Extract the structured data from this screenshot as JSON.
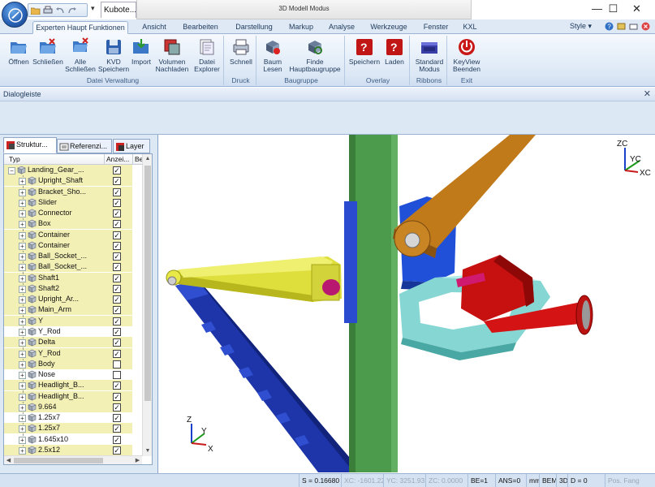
{
  "window": {
    "doc_title": "Kubote...",
    "mode_title": "3D Modell Modus",
    "minimize": "—",
    "maximize": "☐",
    "close": "✕"
  },
  "ribbon": {
    "tabs": [
      "Experten Haupt Funktionen",
      "Ansicht",
      "Bearbeiten",
      "Darstellung",
      "Markup",
      "Analyse",
      "Werkzeuge",
      "Fenster",
      "KXL"
    ],
    "style_label": "Style",
    "groups": {
      "datei": "Datei Verwaltung",
      "druck": "Druck",
      "baugruppe": "Baugruppe",
      "overlay": "Overlay",
      "ribbons": "Ribbons",
      "exit": "Exit"
    },
    "buttons": {
      "oeffnen": "Öffnen",
      "schliessen": "Schließen",
      "alle_l1": "Alle",
      "alle_l2": "Schließen",
      "kvd_l1": "KVD",
      "kvd_l2": "Speichern",
      "import": "Import",
      "volumen_l1": "Volumen",
      "volumen_l2": "Nachladen",
      "datei_l1": "Datei",
      "datei_l2": "Explorer",
      "schnell": "Schnell",
      "baum_l1": "Baum",
      "baum_l2": "Lesen",
      "finde_l1": "Finde",
      "finde_l2": "Hauptbaugruppe",
      "speichern": "Speichern",
      "laden": "Laden",
      "standard_l1": "Standard",
      "standard_l2": "Modus",
      "keyview_l1": "KeyView",
      "keyview_l2": "Beenden"
    }
  },
  "dialog": {
    "title": "Dialogleiste",
    "close": "✕"
  },
  "panel": {
    "tabs": [
      "Struktur...",
      "Referenzi...",
      "Layer"
    ],
    "columns": {
      "typ": "Typ",
      "anzeige": "Anzei...",
      "be": "Be"
    },
    "rows": [
      {
        "label": "Landing_Gear_...",
        "checked": true,
        "hl": true,
        "root": true
      },
      {
        "label": "Upright_Shaft",
        "checked": true,
        "hl": true
      },
      {
        "label": "Bracket_Sho...",
        "checked": true,
        "hl": true
      },
      {
        "label": "Slider",
        "checked": true,
        "hl": true
      },
      {
        "label": "Connector",
        "checked": true,
        "hl": true
      },
      {
        "label": "Box",
        "checked": true,
        "hl": true
      },
      {
        "label": "Container",
        "checked": true,
        "hl": true
      },
      {
        "label": "Container",
        "checked": true,
        "hl": true
      },
      {
        "label": "Ball_Socket_...",
        "checked": true,
        "hl": true
      },
      {
        "label": "Ball_Socket_...",
        "checked": true,
        "hl": true
      },
      {
        "label": "Shaft1",
        "checked": true,
        "hl": true
      },
      {
        "label": "Shaft2",
        "checked": true,
        "hl": true
      },
      {
        "label": "Upright_Ar...",
        "checked": true,
        "hl": true
      },
      {
        "label": "Main_Arm",
        "checked": true,
        "hl": true
      },
      {
        "label": "Y",
        "checked": true,
        "hl": true
      },
      {
        "label": "Y_Rod",
        "checked": true,
        "hl": false
      },
      {
        "label": "Delta",
        "checked": true,
        "hl": true
      },
      {
        "label": "Y_Rod",
        "checked": true,
        "hl": true
      },
      {
        "label": "Body",
        "checked": false,
        "hl": true
      },
      {
        "label": "Nose",
        "checked": false,
        "hl": false
      },
      {
        "label": "Headlight_B...",
        "checked": true,
        "hl": true
      },
      {
        "label": "Headlight_B...",
        "checked": true,
        "hl": true
      },
      {
        "label": "9.664",
        "checked": true,
        "hl": true
      },
      {
        "label": "1.25x7",
        "checked": true,
        "hl": false
      },
      {
        "label": "1.25x7",
        "checked": true,
        "hl": true
      },
      {
        "label": "1.645x10",
        "checked": true,
        "hl": false
      },
      {
        "label": "2.5x12",
        "checked": true,
        "hl": true
      }
    ]
  },
  "axes": {
    "top": {
      "z": "ZC",
      "y": "YC",
      "x": "XC"
    },
    "bottom": {
      "z": "Z",
      "y": "Y",
      "x": "X"
    }
  },
  "status": {
    "s": "S = 0.16680",
    "xc": "XC: -1601.22",
    "yc": "YC: 3251.931",
    "zc": "ZC: 0.0000",
    "be": "BE=1",
    "ans": "ANS=0",
    "mm": "mm",
    "bem": "BEM",
    "mode3d": "3D",
    "d": "D = 0",
    "pos": "Pos. Fang"
  },
  "colors": {
    "ribbon_bg": "#dbe7f5",
    "highlight_row": "#f3f0b6",
    "pillar": "#4e9a4e",
    "arm_blue": "#1d3fb0",
    "arm_yellow": "#e0e040",
    "arm_brown": "#c07a1a",
    "part_cyan": "#86d7d3",
    "part_red": "#d10f0f"
  }
}
